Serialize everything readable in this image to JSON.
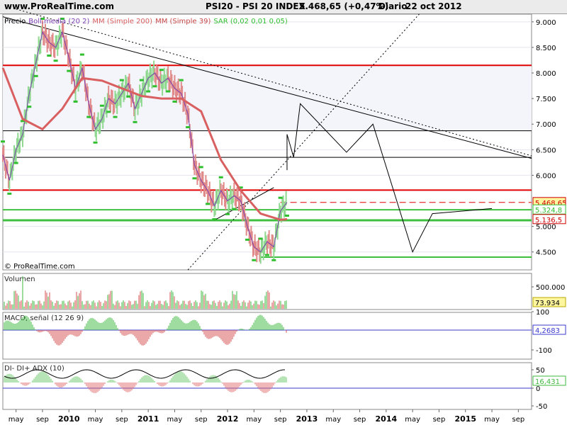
{
  "header": {
    "site": "www.ProRealTime.com",
    "title": "PSI20 - PSI 20 INDEX",
    "price": "5.468,65 (+0,47%)",
    "period": "Diario",
    "date": "22 oct 2012"
  },
  "watermark": "© ProRealTime.com",
  "chart_data": [
    {
      "type": "line",
      "panel": "price",
      "legend": [
        "Precio",
        "Boll.media (20 2)",
        "MM (Simple 200)",
        "MM (Simple 39)",
        "SAR (0,02 0,01 0,05)"
      ],
      "legend_colors": [
        "#000000",
        "#7b3fb0",
        "#d96060",
        "#c84848",
        "#2fbf2f"
      ],
      "y_ticks": [
        "9.000",
        "8.500",
        "8.000",
        "7.500",
        "7.000",
        "6.500",
        "6.000",
        "5.000",
        "4.500"
      ],
      "ylim": [
        4150,
        9150
      ],
      "price_labels": [
        {
          "text": "5.468,65",
          "value": 5468.65,
          "color": "#d00000",
          "bg": "#fff7a0"
        },
        {
          "text": "5.324,8",
          "value": 5324.8,
          "color": "#2fbf2f",
          "bg": "#ffffff"
        },
        {
          "text": "5.136,5",
          "value": 5136.5,
          "color": "#d00000",
          "bg": "#ffffff"
        }
      ],
      "x_ticks": [
        "may",
        "sep",
        "2010",
        "may",
        "sep",
        "2011",
        "may",
        "sep",
        "2012",
        "may",
        "sep",
        "2013",
        "may",
        "sep",
        "2014",
        "may",
        "sep",
        "2015",
        "may",
        "sep"
      ],
      "x_tick_dates": [
        "2009-05",
        "2009-09",
        "2010-01",
        "2010-05",
        "2010-09",
        "2011-01",
        "2011-05",
        "2011-09",
        "2012-01",
        "2012-05",
        "2012-09",
        "2013-01",
        "2013-05",
        "2013-09",
        "2014-01",
        "2014-05",
        "2014-09",
        "2015-01",
        "2015-05",
        "2015-09"
      ],
      "series": [
        {
          "name": "Precio",
          "color": "#6b6b6b",
          "x": [
            "2009-03",
            "2009-04",
            "2009-05",
            "2009-06",
            "2009-07",
            "2009-08",
            "2009-09",
            "2009-10",
            "2009-11",
            "2009-12",
            "2010-01",
            "2010-02",
            "2010-03",
            "2010-04",
            "2010-05",
            "2010-06",
            "2010-07",
            "2010-08",
            "2010-09",
            "2010-10",
            "2010-11",
            "2010-12",
            "2011-01",
            "2011-02",
            "2011-03",
            "2011-04",
            "2011-05",
            "2011-06",
            "2011-07",
            "2011-08",
            "2011-09",
            "2011-10",
            "2011-11",
            "2011-12",
            "2012-01",
            "2012-02",
            "2012-03",
            "2012-04",
            "2012-05",
            "2012-06",
            "2012-07",
            "2012-08",
            "2012-09",
            "2012-10"
          ],
          "y": [
            6400,
            5900,
            6500,
            6800,
            7600,
            8200,
            8800,
            8600,
            8500,
            8800,
            8300,
            7700,
            8100,
            7400,
            6900,
            7100,
            7500,
            7400,
            7600,
            7800,
            7300,
            7600,
            7900,
            8000,
            7800,
            7900,
            7700,
            7600,
            7200,
            6200,
            5900,
            5700,
            5400,
            5700,
            5500,
            5600,
            5500,
            5000,
            4600,
            4500,
            4700,
            4600,
            5300,
            5470
          ]
        },
        {
          "name": "MM (Simple 200)",
          "color": "#d96060",
          "x": [
            "2009-03",
            "2009-06",
            "2009-09",
            "2009-12",
            "2010-03",
            "2010-06",
            "2010-09",
            "2010-12",
            "2011-03",
            "2011-06",
            "2011-09",
            "2011-12",
            "2012-03",
            "2012-06",
            "2012-09",
            "2012-10"
          ],
          "y": [
            8100,
            7100,
            6900,
            7300,
            7900,
            7850,
            7700,
            7550,
            7500,
            7500,
            7250,
            6300,
            5700,
            5250,
            5130,
            5140
          ]
        }
      ],
      "horizontal_lines": [
        {
          "value": 8150,
          "color": "#e00000"
        },
        {
          "value": 6870,
          "color": "#000000"
        },
        {
          "value": 6350,
          "color": "#000000"
        },
        {
          "value": 5710,
          "color": "#e00000"
        },
        {
          "value": 5470,
          "color": "#e00000",
          "dashed": true
        },
        {
          "value": 5325,
          "color": "#3fbf3f"
        },
        {
          "value": 5120,
          "color": "#3fbf3f"
        },
        {
          "value": 4400,
          "color": "#3fbf3f"
        }
      ],
      "projection": {
        "x": [
          "2012-10",
          "2012-10",
          "2012-11",
          "2012-12",
          "2013-07",
          "2013-11",
          "2014-05",
          "2014-08",
          "2015-05"
        ],
        "y": [
          6100,
          6800,
          6350,
          7400,
          6450,
          7000,
          4500,
          5250,
          5350
        ]
      }
    },
    {
      "type": "bar",
      "panel": "volume",
      "title": "Volumen",
      "y_ticks": [
        "500.000"
      ],
      "last_value": "73.934"
    },
    {
      "type": "bar",
      "panel": "macd",
      "title": "MACD, señal (12 26 9)",
      "y_ticks": [
        "100",
        "-100"
      ],
      "last_value": "4,2683"
    },
    {
      "type": "line",
      "panel": "dmi",
      "title": "DI- DI+ ADX (10)",
      "y_ticks": [
        "50",
        "0",
        "-50"
      ],
      "last_value": "16,431"
    }
  ]
}
